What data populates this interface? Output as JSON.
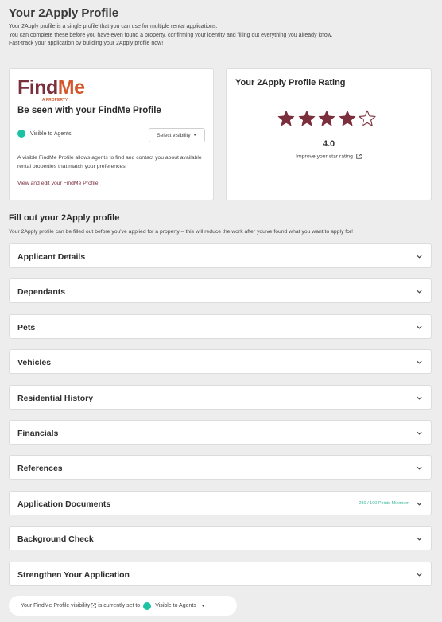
{
  "header": {
    "title": "Your 2Apply Profile",
    "intro_lines": [
      "Your 2Apply profile is a single profile that you can use for multiple rental applications.",
      "You can complete these before you have even found a property, confirming your identity and filling out everything you already know.",
      "Fast-track your application by building your 2Apply profile now!"
    ]
  },
  "findme": {
    "logo_find": "Find",
    "logo_me": "Me",
    "logo_sub": "A PROPERTY",
    "heading": "Be seen with your FindMe Profile",
    "visibility_label": "Visible to Agents",
    "visibility_select": "Select visibility",
    "description": "A visible FindMe Profile allows agents to find and contact you about available rental properties that match your preferences.",
    "link": "View and edit your FindMe Profile"
  },
  "rating": {
    "title": "Your 2Apply Profile Rating",
    "value": "4.0",
    "stars_filled": 4,
    "stars_total": 5,
    "improve_link": "Improve your star rating",
    "star_color": "#7b2e3c"
  },
  "profile": {
    "heading": "Fill out your 2Apply profile",
    "subtext": "Your 2Apply profile can be filled out before you've applied for a property – this will reduce the work after you've found what you want to apply for!",
    "sections": [
      {
        "label": "Applicant Details",
        "badge": ""
      },
      {
        "label": "Dependants",
        "badge": ""
      },
      {
        "label": "Pets",
        "badge": ""
      },
      {
        "label": "Vehicles",
        "badge": ""
      },
      {
        "label": "Residential History",
        "badge": ""
      },
      {
        "label": "Financials",
        "badge": ""
      },
      {
        "label": "References",
        "badge": ""
      },
      {
        "label": "Application Documents",
        "badge": "250 / 100 Points Minimum"
      },
      {
        "label": "Background Check",
        "badge": ""
      },
      {
        "label": "Strengthen Your Application",
        "badge": ""
      }
    ]
  },
  "footer": {
    "prefix": "Your FindMe Profile visibility",
    "middle": "is currently set to",
    "value": "Visible to Agents"
  },
  "colors": {
    "accent": "#7b2e3c",
    "brand_orange": "#d4572c",
    "visible_green": "#1bc3a4"
  }
}
